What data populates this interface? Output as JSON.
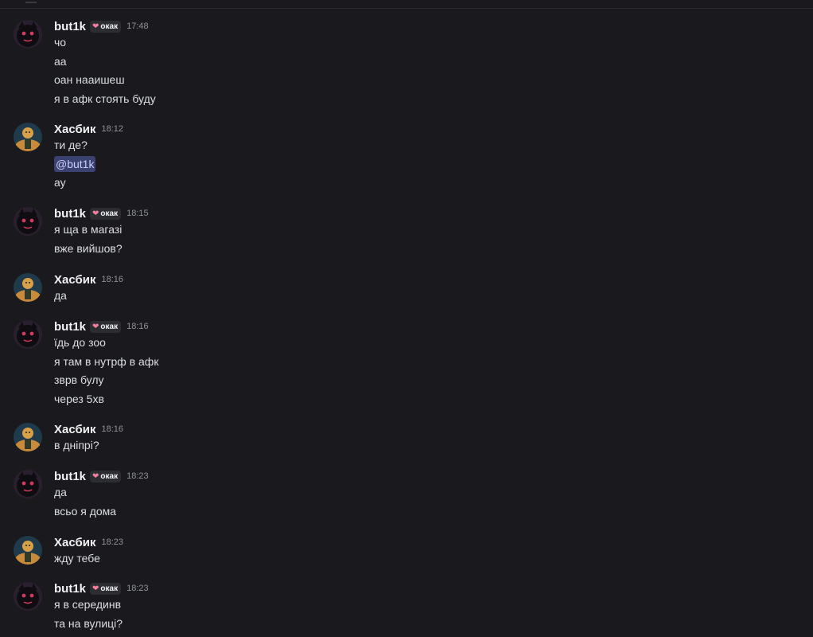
{
  "colors": {
    "background": "#1a1a1e",
    "username": "#f2f3f5",
    "message_text": "#dbdee1",
    "timestamp": "#8e9297",
    "badge_bg": "#2b2d31",
    "heart": "#f47fa1",
    "mention_bg": "#3c4270",
    "mention_text": "#c9cdfb"
  },
  "groups": [
    {
      "username": "but1k",
      "badge": "окак",
      "badge_icon": "heart-icon",
      "time": "17:48",
      "avatar": "black-cat-avatar",
      "messages": [
        "чо",
        "аа",
        "оан нааишеш",
        "я в афк стоять буду"
      ]
    },
    {
      "username": "Хасбик",
      "time": "18:12",
      "avatar": "bodybuilder-avatar",
      "messages": [
        "ти де?",
        "@but1k",
        "ау"
      ]
    },
    {
      "username": "but1k",
      "badge": "окак",
      "badge_icon": "heart-icon",
      "time": "18:15",
      "avatar": "black-cat-avatar",
      "messages": [
        "я ща в магазі",
        "вже вийшов?"
      ]
    },
    {
      "username": "Хасбик",
      "time": "18:16",
      "avatar": "bodybuilder-avatar",
      "messages": [
        "да"
      ]
    },
    {
      "username": "but1k",
      "badge": "окак",
      "badge_icon": "heart-icon",
      "time": "18:16",
      "avatar": "black-cat-avatar",
      "messages": [
        "їдь до зоо",
        "я там в нутрф в афк",
        "зврв булу",
        "через 5хв"
      ]
    },
    {
      "username": "Хасбик",
      "time": "18:16",
      "avatar": "bodybuilder-avatar",
      "messages": [
        "в дніпрі?"
      ]
    },
    {
      "username": "but1k",
      "badge": "окак",
      "badge_icon": "heart-icon",
      "time": "18:23",
      "avatar": "black-cat-avatar",
      "messages": [
        "да",
        "всьо я дома"
      ]
    },
    {
      "username": "Хасбик",
      "time": "18:23",
      "avatar": "bodybuilder-avatar",
      "messages": [
        "жду тебе"
      ]
    },
    {
      "username": "but1k",
      "badge": "окак",
      "badge_icon": "heart-icon",
      "time": "18:23",
      "avatar": "black-cat-avatar",
      "messages": [
        "я в серединв",
        "та на вулиці?"
      ]
    }
  ]
}
